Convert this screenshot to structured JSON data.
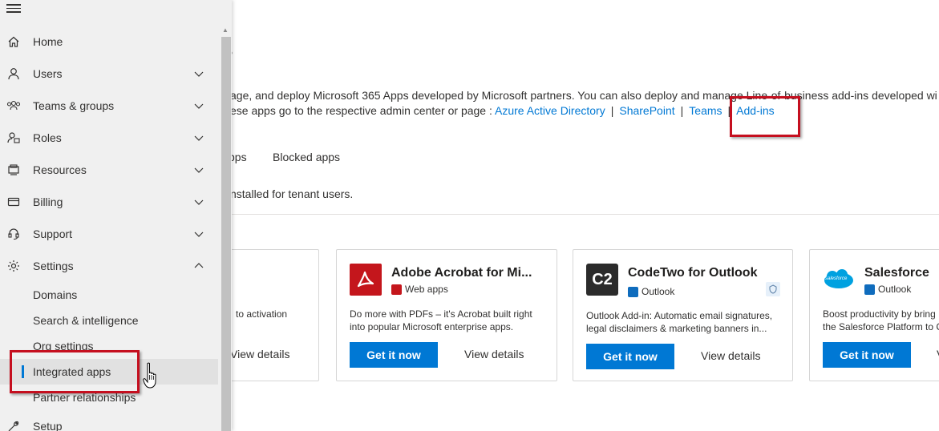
{
  "page": {
    "title": "s",
    "description_line1": "age, and deploy Microsoft 365 Apps developed by Microsoft partners. You can also deploy and manage Line-of-business add-ins developed wi",
    "description_line2_prefix": "ese apps go to the respective admin center or page :",
    "links": [
      "Azure Active Directory",
      "SharePoint",
      "Teams",
      "Add-ins"
    ],
    "separator": "|",
    "tabs": [
      "pps",
      "Blocked apps"
    ],
    "tab_note": "nstalled for tenant users."
  },
  "cards": [
    {
      "title": "",
      "subtitle": "",
      "description": [
        "to activation",
        ""
      ],
      "primary_button": "",
      "secondary_button": "View details"
    },
    {
      "title": "Adobe Acrobat for Mi...",
      "subtitle": "Web apps",
      "description": [
        "Do more with PDFs – it's Acrobat built right",
        "into popular Microsoft enterprise apps."
      ],
      "primary_button": "Get it now",
      "secondary_button": "View details",
      "logo_color": "#c4161c"
    },
    {
      "title": "CodeTwo for Outlook",
      "subtitle": "Outlook",
      "logo_text": "C2",
      "description": [
        "Outlook Add-in: Automatic email signatures,",
        "legal disclaimers & marketing banners in..."
      ],
      "primary_button": "Get it now",
      "secondary_button": "View details",
      "logo_color": "#2b2b2b"
    },
    {
      "title": "Salesforce",
      "subtitle": "Outlook",
      "logo_text": "salesforce",
      "description": [
        "Boost productivity by bring",
        "the Salesforce Platform to C"
      ],
      "primary_button": "Get it now",
      "secondary_button": "V",
      "logo_color": "#00a1e0"
    }
  ],
  "sidebar": {
    "items": [
      {
        "label": "Home",
        "icon": "home-icon"
      },
      {
        "label": "Users",
        "icon": "user-icon",
        "expandable": true
      },
      {
        "label": "Teams & groups",
        "icon": "teams-icon",
        "expandable": true
      },
      {
        "label": "Roles",
        "icon": "roles-icon",
        "expandable": true
      },
      {
        "label": "Resources",
        "icon": "resources-icon",
        "expandable": true
      },
      {
        "label": "Billing",
        "icon": "billing-icon",
        "expandable": true
      },
      {
        "label": "Support",
        "icon": "headset-icon",
        "expandable": true
      },
      {
        "label": "Settings",
        "icon": "gear-icon",
        "expanded": true
      }
    ],
    "settings_children": [
      "Domains",
      "Search & intelligence",
      "Org settings",
      "Integrated apps",
      "Partner relationships"
    ],
    "active_child": "Integrated apps",
    "after": [
      {
        "label": "Setup",
        "icon": "wrench-icon"
      }
    ]
  },
  "colors": {
    "accent": "#0078d4",
    "highlight_box": "#c50f1f",
    "sidebar_bg": "#f0f0f0"
  }
}
